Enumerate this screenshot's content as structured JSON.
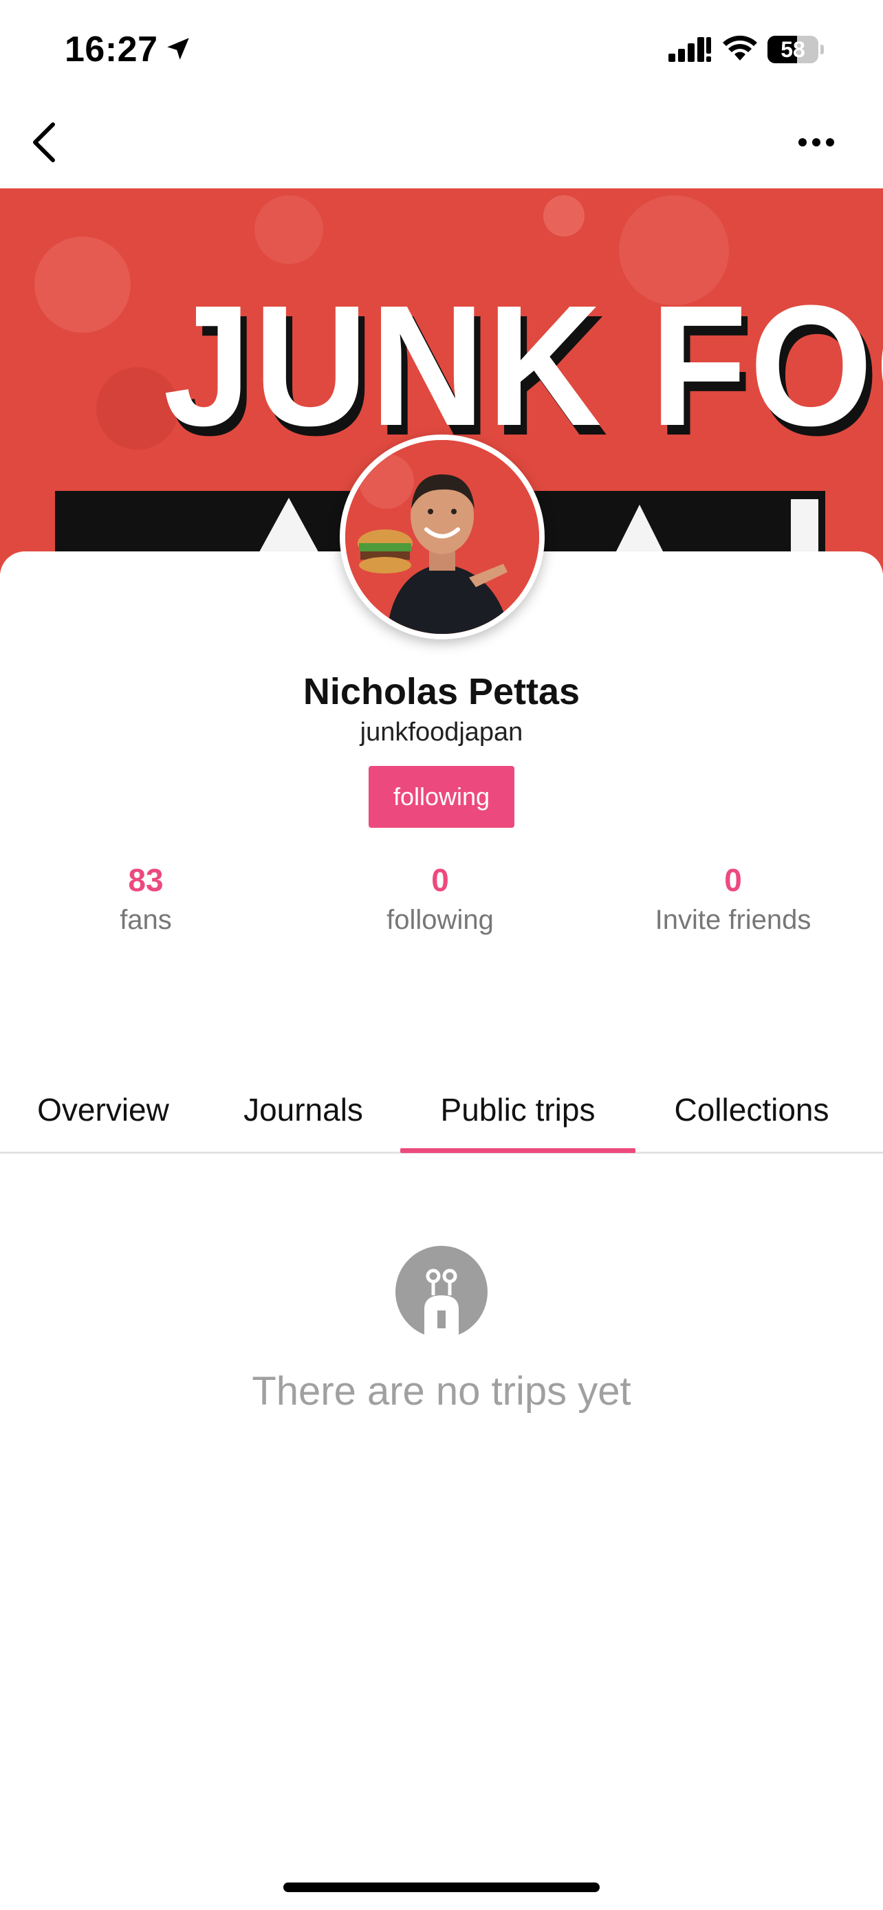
{
  "status_bar": {
    "time": "16:27",
    "battery_level": "58",
    "icons": [
      "location-arrow-icon",
      "cellular-signal-icon",
      "wifi-icon",
      "battery-icon"
    ]
  },
  "nav": {
    "back_icon": "chevron-left-icon",
    "more_icon": "more-horizontal-icon"
  },
  "banner": {
    "text": "JUNK FOOD",
    "background_color": "#e0493f"
  },
  "profile": {
    "name": "Nicholas Pettas",
    "handle": "junkfoodjapan",
    "follow_button_label": "following"
  },
  "stats": [
    {
      "value": "83",
      "label": "fans"
    },
    {
      "value": "0",
      "label": "following"
    },
    {
      "value": "0",
      "label": "Invite friends"
    }
  ],
  "tabs": [
    {
      "label": "Overview",
      "active": false
    },
    {
      "label": "Journals",
      "active": false
    },
    {
      "label": "Public trips",
      "active": true
    },
    {
      "label": "Collections",
      "active": false
    }
  ],
  "empty_state": {
    "icon": "empty-trips-icon",
    "message": "There are no trips yet"
  },
  "colors": {
    "accent": "#ec4a7e",
    "muted_text": "#a0a0a0"
  }
}
